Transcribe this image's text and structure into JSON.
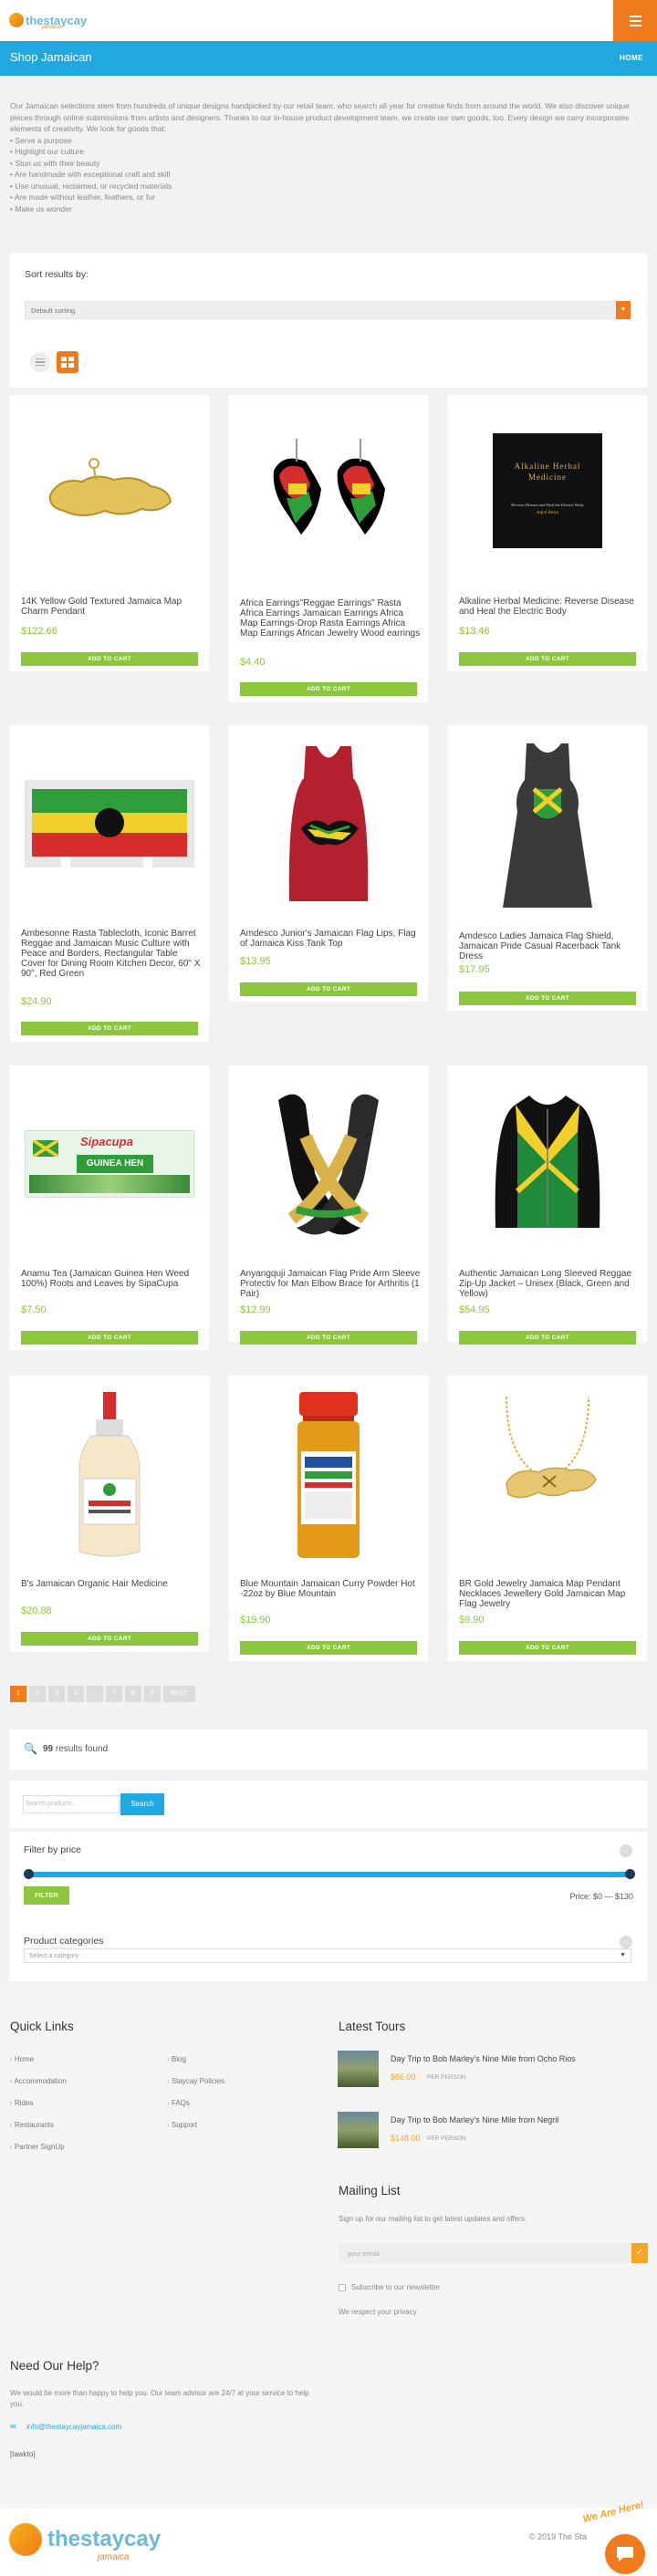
{
  "header": {
    "logo_text": "thestaycay",
    "logo_sub": "jamaica",
    "menu_icon": "hamburger-icon"
  },
  "titlebar": {
    "title": "Shop Jamaican",
    "home": "HOME"
  },
  "intro": {
    "paragraph": "Our Jamaican selections stem from hundreds of unique designs handpicked by our retail team, who search all year for creative finds from around the world. We also discover unique pieces through online submissions from artists and designers. Thanks to our in-house product development team, we create our own goods, too. Every design we carry incorporates elements of creativity. We look for goods that:",
    "bullets": [
      "Serve a purpose",
      "Highlight our culture",
      "Stun us with their beauty",
      "Are handmade with exceptional craft and skill",
      "Use unusual, reclaimed, or recycled materials",
      "Are made without leather, feathers, or fur",
      "Make us wonder"
    ]
  },
  "sort": {
    "label": "Sort results by:",
    "selected": "Default sorting"
  },
  "cart_label": "ADD TO CART",
  "products": [
    {
      "name": "14K Yellow Gold Textured Jamaica Map Charm Pendant",
      "price": "$122.66"
    },
    {
      "name": "Africa Earrings\"Reggae Earrings\" Rasta Africa Earrings Jamaican Earrings Africa Map Earrings-Drop Rasta Earrings Africa Map Earrings African Jewelry Wood earrings",
      "price": "$4.40"
    },
    {
      "name": "Alkaline Herbal Medicine: Reverse Disease and Heal the Electric Body",
      "price": "$13.46"
    },
    {
      "name": "Ambesonne Rasta Tablecloth, Iconic Barret Reggae and Jamaican Music Culture with Peace and Borders, Rectangular Table Cover for Dining Room Kitchen Decor, 60\" X 90\", Red Green",
      "price": "$24.90"
    },
    {
      "name": "Amdesco Junior's Jamaican Flag Lips, Flag of Jamaica Kiss Tank Top",
      "price": "$13.95"
    },
    {
      "name": "Amdesco Ladies Jamaica Flag Shield, Jamaican Pride Casual Racerback Tank Dress",
      "price": "$17.95"
    },
    {
      "name": "Anamu Tea (Jamaican Guinea Hen Weed 100%) Roots and Leaves by SipaCupa",
      "price": "$7.50"
    },
    {
      "name": "Anyangquji Jamaican Flag Pride Arm Sleeve Protectiv for Man Elbow Brace for Arthritis (1 Pair)",
      "price": "$12.99"
    },
    {
      "name": "Authentic Jamaican Long Sleeved Reggae Zip-Up Jacket – Unisex (Black, Green and Yellow)",
      "price": "$54.95"
    },
    {
      "name": "B's Jamaican Organic Hair Medicine",
      "price": "$20.88"
    },
    {
      "name": "Blue Mountain Jamaican Curry Powder Hot -22oz by Blue Mountain",
      "price": "$19.90"
    },
    {
      "name": "BR Gold Jewelry Jamaica Map Pendant Necklaces Jewellery Gold Jamaican Map Flag Jewelry",
      "price": "$9.90"
    }
  ],
  "book": {
    "title": "Alkaline Herbal Medicine",
    "subtitle": "Reverse Disease and Heal the Electric Body",
    "author": "Aqiyl Aniys"
  },
  "tea_label": "Sipacupa",
  "tea_sub": "GUINEA HEN",
  "pagination": [
    "1",
    "2",
    "3",
    "4",
    "...",
    "7",
    "8",
    "9",
    "NEXT"
  ],
  "results": {
    "count": "99",
    "text": "results found"
  },
  "search": {
    "placeholder": "Search products...",
    "button": "Search"
  },
  "price_filter": {
    "title": "Filter by price",
    "button": "FILTER",
    "label": "Price: $0 — $130",
    "min": 0,
    "max": 130
  },
  "categories": {
    "title": "Product categories",
    "placeholder": "Select a category"
  },
  "footer": {
    "quick_links_title": "Quick Links",
    "links_col1": [
      "Home",
      "Accommodation",
      "Rides",
      "Restaurants",
      "Partner SignUp"
    ],
    "links_col2": [
      "Blog",
      "Staycay Policies",
      "FAQs",
      "Support"
    ],
    "tours_title": "Latest Tours",
    "tours": [
      {
        "name": "Day Trip to Bob Marley's Nine Mile from Ocho Rios",
        "price": "$66.00",
        "per": "PER PERSON"
      },
      {
        "name": "Day Trip to Bob Marley's Nine Mile from Negril",
        "price": "$148.00",
        "per": "PER PERSON"
      }
    ],
    "mailing_title": "Mailing List",
    "mailing_text": "Sign up for our mailing list to get latest updates and offers.",
    "email_placeholder": "your email",
    "subscribe_label": "Subscribe to our newsletter",
    "privacy": "We respect your privacy",
    "help_title": "Need Our Help?",
    "help_text": "We would be more than happy to help you. Our team advisor are 24/7 at your service to help you.",
    "email": "info@thestaycayjamaica.com",
    "shortcode": "[tawkto]"
  },
  "bottom": {
    "copyright": "© 2019 The Sta",
    "badge": "We Are Here!"
  }
}
